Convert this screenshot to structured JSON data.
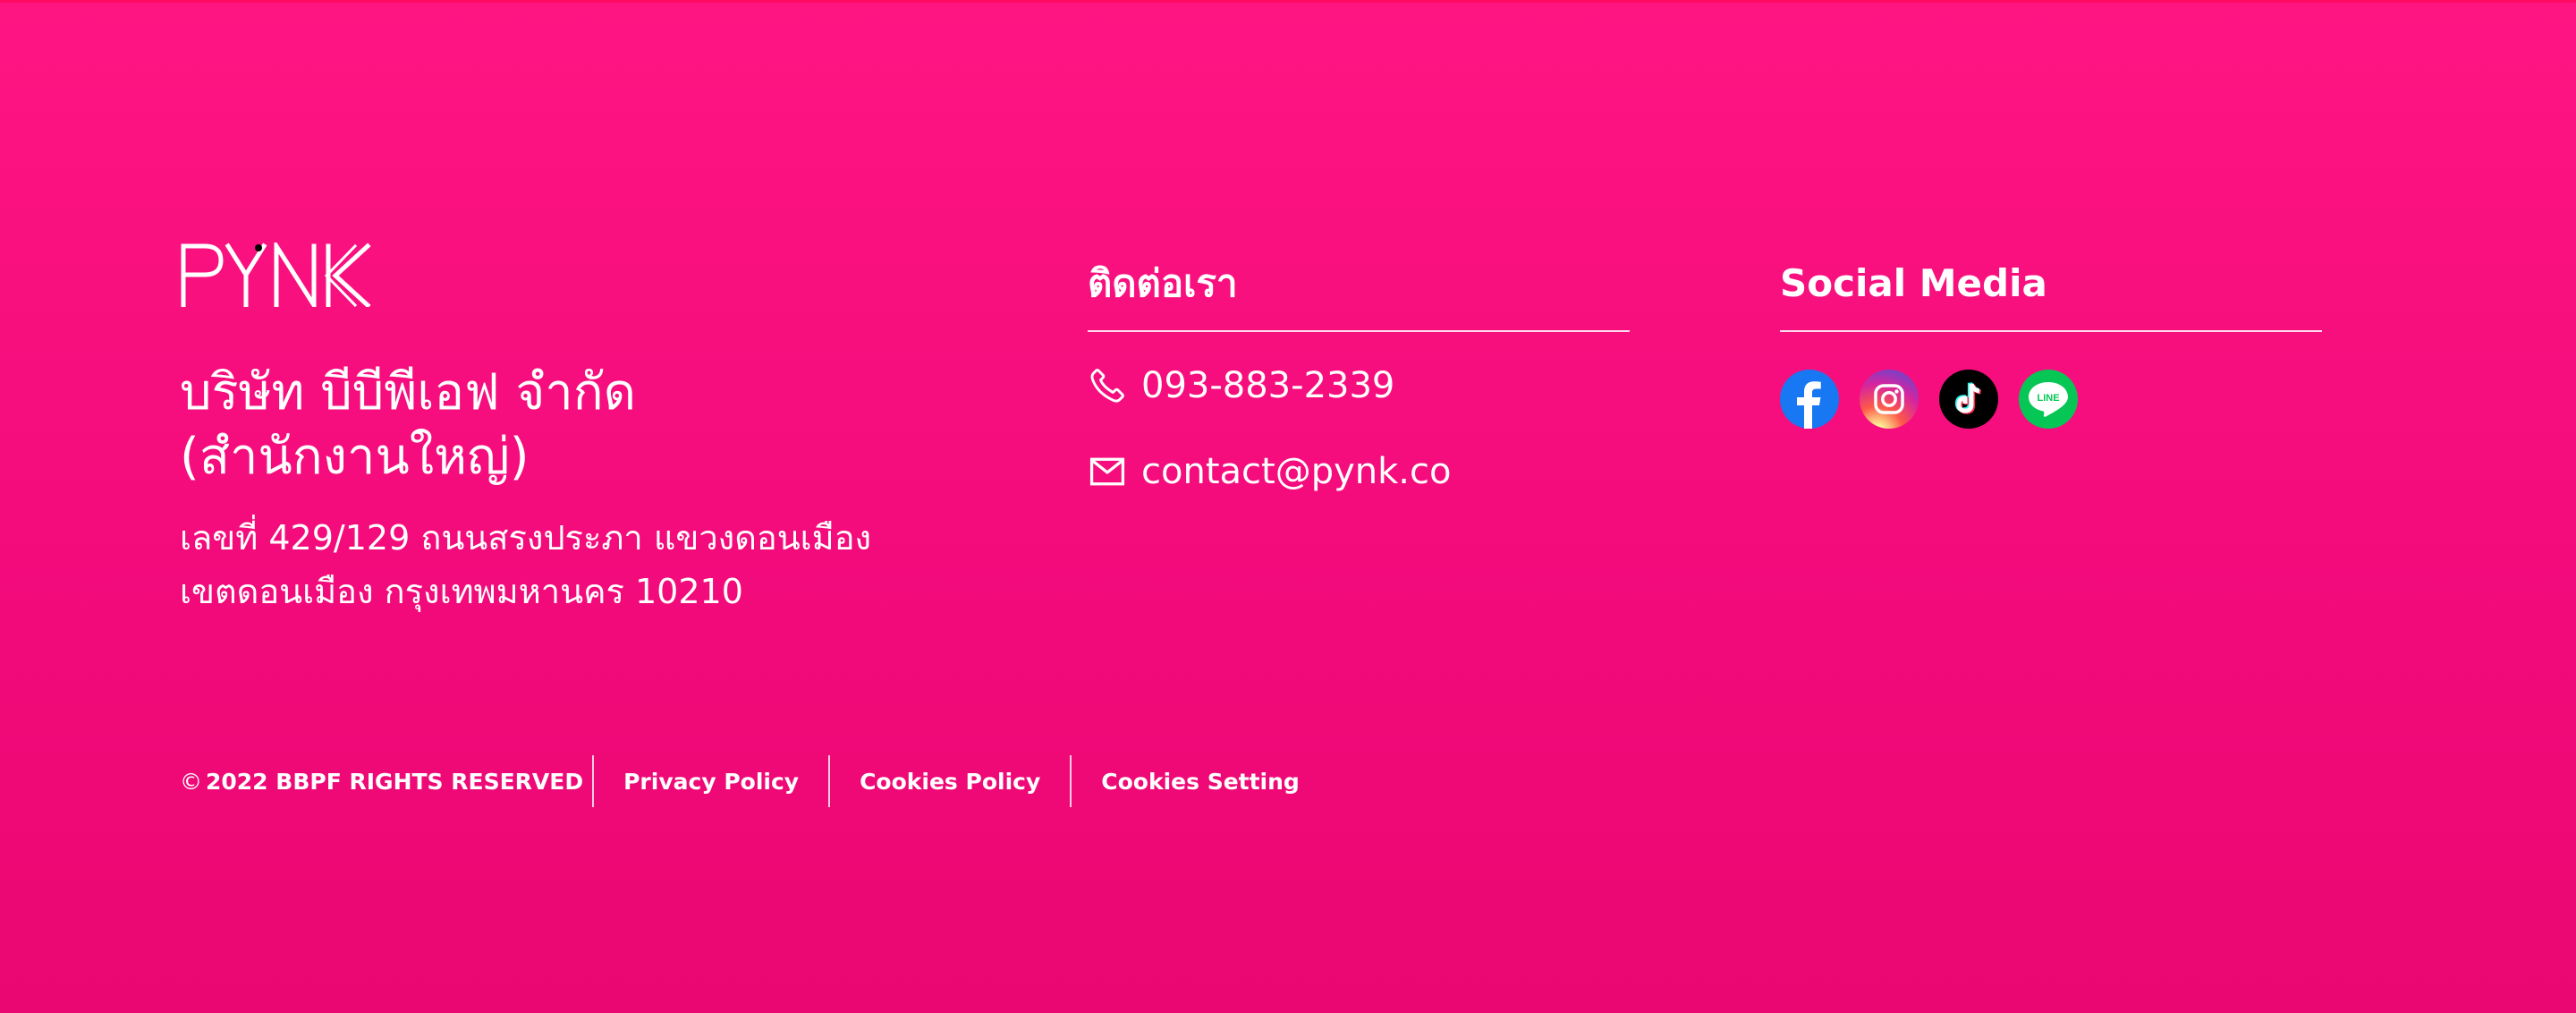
{
  "brand": {
    "logo_text": "PYNK",
    "company_name_line1": "บริษัท บีบีพีเอฟ จำกัด",
    "company_name_line2": "(สำนักงานใหญ่)",
    "address_line1": "เลขที่ 429/129 ถนนสรงประภา แขวงดอนเมือง",
    "address_line2": "เขตดอนเมือง กรุงเทพมหานคร 10210"
  },
  "contact": {
    "heading": "ติดต่อเรา",
    "phone": "093-883-2339",
    "email": "contact@pynk.co"
  },
  "social": {
    "heading": "Social Media",
    "icons": [
      "facebook-icon",
      "instagram-icon",
      "tiktok-icon",
      "line-icon"
    ],
    "line_badge_text": "LINE"
  },
  "legal": {
    "copyright_symbol": "©",
    "copyright_text": "2022 BBPF RIGHTS RESERVED",
    "links": [
      "Privacy Policy",
      "Cookies Policy",
      "Cookies Setting"
    ]
  },
  "colors": {
    "background_top": "#ff1582",
    "background_bottom": "#ea0771",
    "text": "#ffffff",
    "facebook": "#1877f2",
    "tiktok_bg": "#000000",
    "line": "#06c755"
  }
}
